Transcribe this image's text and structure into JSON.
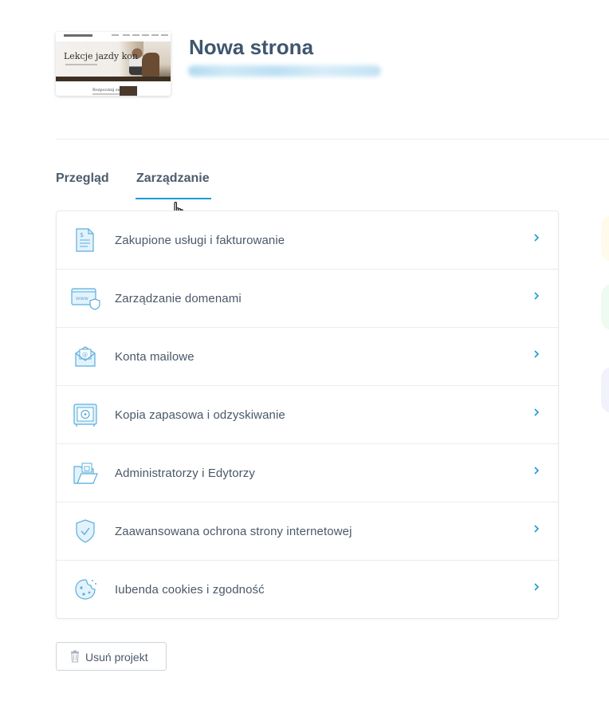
{
  "project": {
    "title": "Nowa strona",
    "thumbnail": {
      "hero_title": "Lekcje jazdy kon",
      "section_title": "Rozpocznij się"
    }
  },
  "tabs": [
    {
      "label": "Przegląd",
      "active": false
    },
    {
      "label": "Zarządzanie",
      "active": true
    }
  ],
  "menu": {
    "items": [
      {
        "label": "Zakupione usługi i fakturowanie",
        "icon": "invoice-icon"
      },
      {
        "label": "Zarządzanie domenami",
        "icon": "domain-www-icon"
      },
      {
        "label": "Konta mailowe",
        "icon": "mail-envelope-icon"
      },
      {
        "label": "Kopia zapasowa i odzyskiwanie",
        "icon": "safe-backup-icon"
      },
      {
        "label": "Administratorzy i Edytorzy",
        "icon": "folder-lock-icon"
      },
      {
        "label": "Zaawansowana ochrona strony internetowej",
        "icon": "shield-check-icon"
      },
      {
        "label": "Iubenda cookies i zgodność",
        "icon": "cookie-icon"
      }
    ]
  },
  "actions": {
    "delete_label": "Usuń projekt"
  },
  "colors": {
    "accent": "#1b9bd7",
    "icon_stroke": "#5aaede",
    "icon_fill": "#e3f2fb",
    "title": "#3f5670",
    "text": "#4a5868"
  }
}
